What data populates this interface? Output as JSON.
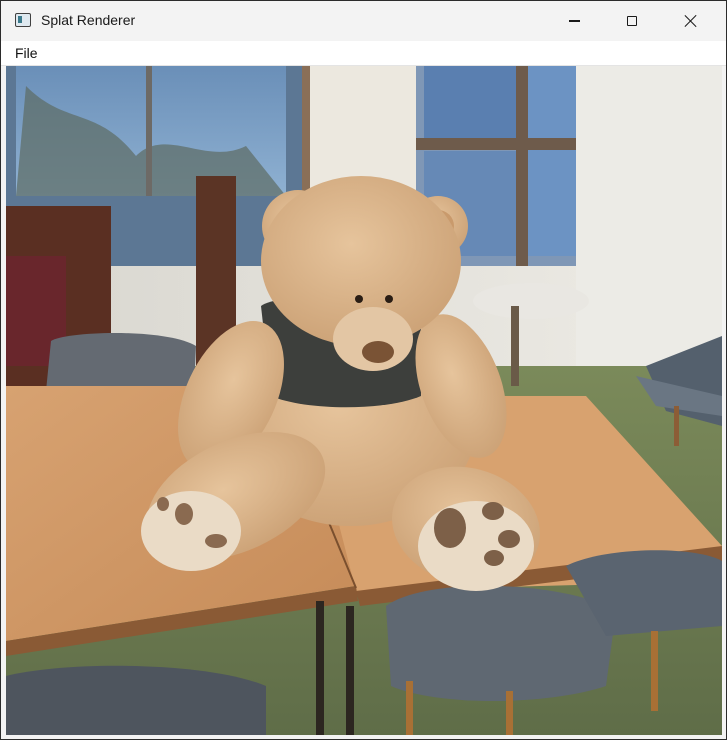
{
  "window": {
    "title": "Splat Renderer",
    "controls": {
      "minimize": "minimize",
      "maximize": "maximize",
      "close": "close"
    }
  },
  "menubar": {
    "items": [
      {
        "label": "File"
      }
    ]
  },
  "viewport": {
    "content": "3D gaussian splat render: teddy bear sitting on wooden tables in a cafe"
  },
  "colors": {
    "titlebar_bg": "#f3f3f3",
    "menubar_bg": "#ffffff",
    "window_border": "#2b2b2b"
  }
}
